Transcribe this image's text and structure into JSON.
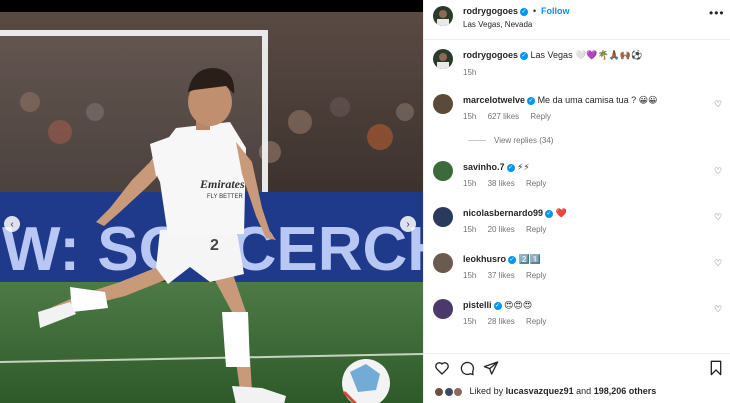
{
  "post": {
    "username": "rodrygogoes",
    "follow_label": "Follow",
    "separator": "•",
    "location": "Las Vegas, Nevada",
    "more_icon": "more-options-icon"
  },
  "caption": {
    "username": "rodrygogoes",
    "text": "Las Vegas 🤍💜🌴🙏🏾🙌🏾⚽",
    "time": "15h"
  },
  "photo": {
    "board_text": "W: SOCCERCH",
    "shirt_brand": "Emirates",
    "shirt_slogan": "FLY BETTER",
    "shirt_number": "2"
  },
  "comments": [
    {
      "username": "marcelotwelve",
      "text": "Me da uma camisa tua ? 😀😀",
      "time": "15h",
      "likes": "627 likes",
      "reply": "Reply",
      "avatar_color": "#5a4a3a"
    },
    {
      "username": "savinho.7",
      "text": "⚡⚡",
      "time": "15h",
      "likes": "38 likes",
      "reply": "Reply",
      "avatar_color": "#3c6a3a"
    },
    {
      "username": "nicolasbernardo99",
      "text": "❤️",
      "time": "15h",
      "likes": "20 likes",
      "reply": "Reply",
      "avatar_color": "#2a3a5a"
    },
    {
      "username": "leokhusro",
      "text": "2️⃣1️⃣",
      "time": "15h",
      "likes": "37 likes",
      "reply": "Reply",
      "avatar_color": "#6a5a50"
    },
    {
      "username": "pistelli",
      "text": "😍😍😍",
      "time": "15h",
      "likes": "28 likes",
      "reply": "Reply",
      "avatar_color": "#4a3a6a"
    }
  ],
  "view_replies": "View replies (34)",
  "likes_summary": {
    "prefix": "Liked by",
    "user": "lucasvazquez91",
    "middle": "and",
    "count": "198,206 others"
  },
  "icons": {
    "like": "heart-icon",
    "comment": "comment-icon",
    "share": "share-icon",
    "save": "bookmark-icon",
    "prev": "chevron-left-icon",
    "next": "chevron-right-icon"
  },
  "colors": {
    "accent": "#0095f6",
    "text": "#262626",
    "secondary": "#737373",
    "heart_red": "#ed4956"
  }
}
